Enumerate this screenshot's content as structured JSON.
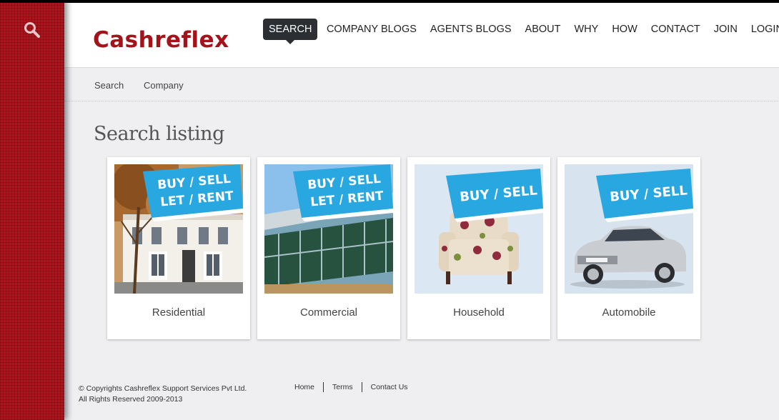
{
  "brand": {
    "logo_text": "Cashreflex",
    "accent_color": "#a4121a",
    "sidebar_color": "#b2121a"
  },
  "sidebar": {
    "search_icon": "search-icon"
  },
  "nav": {
    "items": [
      {
        "label": "SEARCH",
        "active": true
      },
      {
        "label": "COMPANY BLOGS"
      },
      {
        "label": "AGENTS BLOGS"
      },
      {
        "label": "ABOUT"
      },
      {
        "label": "WHY"
      },
      {
        "label": "HOW"
      },
      {
        "label": "CONTACT"
      },
      {
        "label": "JOIN"
      },
      {
        "label": "LOGIN"
      }
    ]
  },
  "subnav": {
    "items": [
      {
        "label": "Search"
      },
      {
        "label": "Company"
      }
    ]
  },
  "main": {
    "title": "Search listing",
    "cards": [
      {
        "label": "Residential",
        "sign_line1": "BUY / SELL",
        "sign_line2": "LET / RENT"
      },
      {
        "label": "Commercial",
        "sign_line1": "BUY / SELL",
        "sign_line2": "LET / RENT"
      },
      {
        "label": "Household",
        "sign_line1": "BUY / SELL"
      },
      {
        "label": "Automobile",
        "sign_line1": "BUY / SELL"
      }
    ]
  },
  "footer": {
    "copyright_line1": "© Copyrights Cashreflex Support Services Pvt Ltd.",
    "copyright_line2": "All Rights Reserved 2009-2013",
    "links": [
      {
        "label": "Home"
      },
      {
        "label": "Terms"
      },
      {
        "label": "Contact Us"
      }
    ]
  }
}
